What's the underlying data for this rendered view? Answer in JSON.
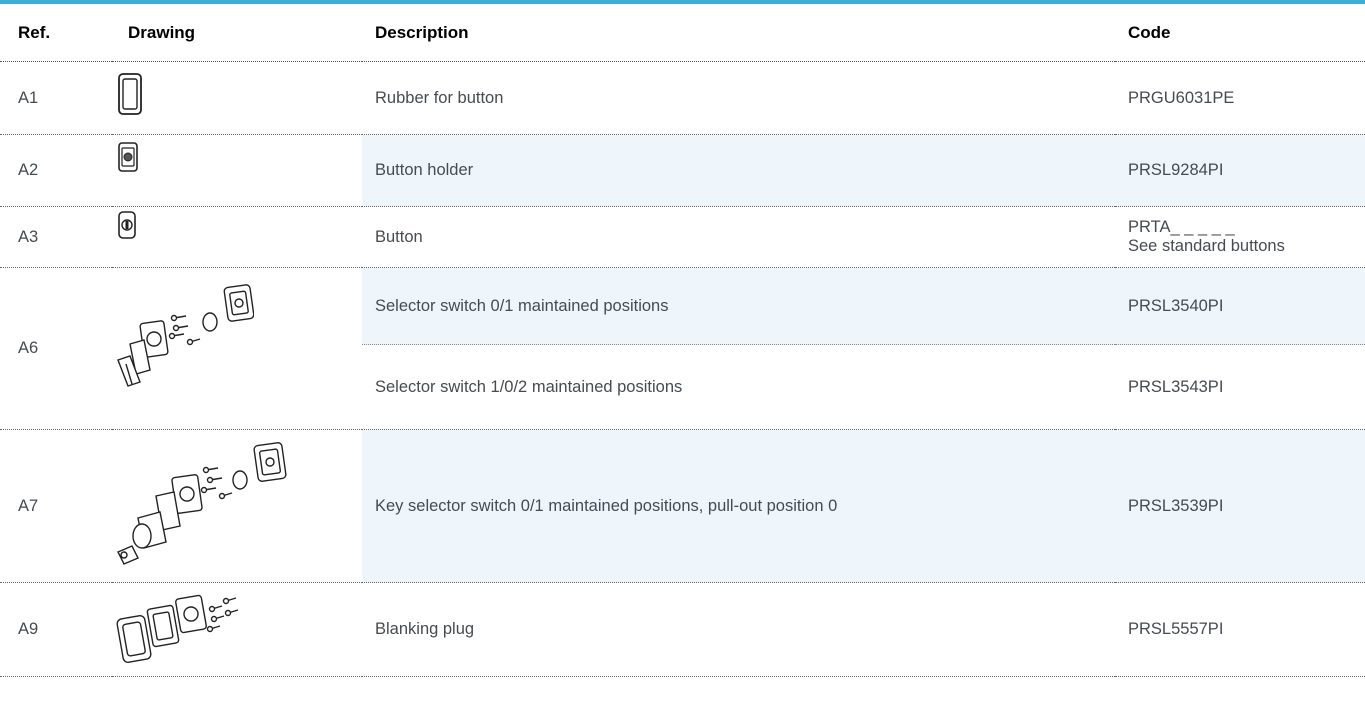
{
  "headers": {
    "ref": "Ref.",
    "drawing": "Drawing",
    "description": "Description",
    "code": "Code"
  },
  "rows": [
    {
      "ref": "A1",
      "description": "Rubber for button",
      "code": "PRGU6031PE"
    },
    {
      "ref": "A2",
      "description": "Button holder",
      "code": "PRSL9284PI"
    },
    {
      "ref": "A3",
      "description": "Button",
      "code_line1": "PRTA_ _ _ _ _",
      "code_line2": "See standard buttons"
    },
    {
      "ref": "A6",
      "description": "Selector switch 0/1 maintained positions",
      "code": "PRSL3540PI"
    },
    {
      "ref": "A6",
      "description": "Selector switch 1/0/2 maintained positions",
      "code": "PRSL3543PI"
    },
    {
      "ref": "A7",
      "description": "Key selector switch 0/1 maintained positions, pull-out position 0",
      "code": "PRSL3539PI"
    },
    {
      "ref": "A9",
      "description": "Blanking plug",
      "code": "PRSL5557PI"
    }
  ],
  "drawings": [
    "rubber-frame-icon",
    "button-holder-icon",
    "button-icon",
    "selector-switch-exploded-icon",
    "key-selector-switch-exploded-icon",
    "blanking-plug-exploded-icon"
  ],
  "colors": {
    "accent": "#35b1de",
    "highlight_row": "#eef6fc"
  }
}
